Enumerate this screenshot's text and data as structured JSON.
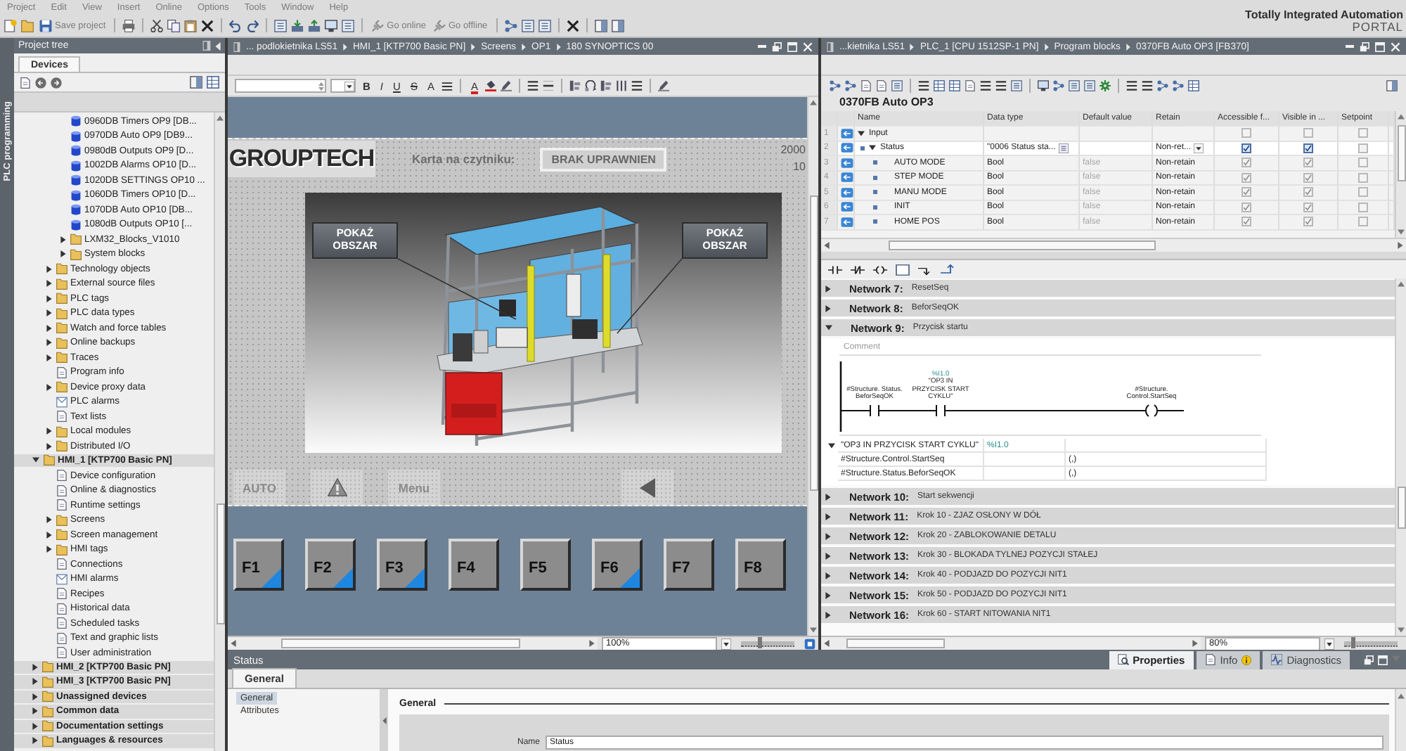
{
  "menu_bar": {
    "items": [
      "Project",
      "Edit",
      "View",
      "Insert",
      "Online",
      "Options",
      "Tools",
      "Window",
      "Help"
    ]
  },
  "toolbar": {
    "buttons": [
      {
        "kind": "save",
        "label": "Save project"
      },
      {
        "kind": "online",
        "label": "Go online"
      },
      {
        "kind": "offline",
        "label": "Go offline"
      }
    ]
  },
  "brand": {
    "title": "Totally Integrated Automation",
    "subtitle": "PORTAL"
  },
  "side_tab": {
    "label": "PLC programming"
  },
  "project_tree": {
    "title": "Project tree",
    "tabs": [
      {
        "label": "Devices",
        "selected": true
      }
    ],
    "items": [
      {
        "children": [
          {
            "children": [
              {
                "label": "0960DB Timers OP9 [DB...",
                "kind": "db"
              },
              {
                "label": "0970DB Auto OP9 [DB9...",
                "kind": "db"
              },
              {
                "label": "0980dB Outputs OP9 [D...",
                "kind": "db"
              },
              {
                "label": "1002DB Alarms OP10 [D...",
                "kind": "db"
              },
              {
                "label": "1020DB SETTINGS OP10 ...",
                "kind": "db"
              },
              {
                "label": "1060DB Timers OP10 [D...",
                "kind": "db"
              },
              {
                "label": "1070DB Auto OP10 [DB...",
                "kind": "db"
              },
              {
                "label": "1080dB Outputs OP10 [...",
                "kind": "db"
              },
              {
                "label": "LXM32_Blocks_V1010",
                "kind": "folder",
                "expanded": false
              },
              {
                "label": "System blocks",
                "kind": "folder",
                "expanded": false
              }
            ]
          },
          {
            "label": "Technology objects",
            "kind": "folder",
            "expanded": false
          },
          {
            "label": "External source files",
            "kind": "folder",
            "expanded": false
          },
          {
            "label": "PLC tags",
            "kind": "folder",
            "expanded": false
          },
          {
            "label": "PLC data types",
            "kind": "folder",
            "expanded": false
          },
          {
            "label": "Watch and force tables",
            "kind": "folder",
            "expanded": false
          },
          {
            "label": "Online backups",
            "kind": "folder",
            "expanded": false
          },
          {
            "label": "Traces",
            "kind": "folder",
            "expanded": false
          },
          {
            "label": "Program info",
            "kind": "item"
          },
          {
            "label": "Device proxy data",
            "kind": "folder",
            "expanded": false
          },
          {
            "label": "PLC alarms",
            "kind": "alarm"
          },
          {
            "label": "Text lists",
            "kind": "item"
          },
          {
            "label": "Local modules",
            "kind": "folder",
            "expanded": false
          },
          {
            "label": "Distributed I/O",
            "kind": "folder",
            "expanded": false
          }
        ]
      },
      {
        "label": "HMI_1 [KTP700 Basic PN]",
        "kind": "folder",
        "expanded": true,
        "children": [
          {
            "label": "Device configuration",
            "kind": "item"
          },
          {
            "label": "Online & diagnostics",
            "kind": "item"
          },
          {
            "label": "Runtime settings",
            "kind": "item"
          },
          {
            "label": "Screens",
            "kind": "folder",
            "expanded": false
          },
          {
            "label": "Screen management",
            "kind": "folder",
            "expanded": false
          },
          {
            "label": "HMI tags",
            "kind": "folder",
            "expanded": false
          },
          {
            "label": "Connections",
            "kind": "item"
          },
          {
            "label": "HMI alarms",
            "kind": "alarm"
          },
          {
            "label": "Recipes",
            "kind": "item"
          },
          {
            "label": "Historical data",
            "kind": "item"
          },
          {
            "label": "Scheduled tasks",
            "kind": "item"
          },
          {
            "label": "Text and graphic lists",
            "kind": "item"
          },
          {
            "label": "User administration",
            "kind": "item"
          }
        ]
      },
      {
        "label": "HMI_2 [KTP700 Basic PN]",
        "kind": "folder",
        "expanded": false
      },
      {
        "label": "HMI_3 [KTP700 Basic PN]",
        "kind": "folder",
        "expanded": false
      },
      {
        "label": "Unassigned devices",
        "kind": "folder",
        "expanded": false
      },
      {
        "label": "Common data",
        "kind": "folder",
        "expanded": false
      },
      {
        "label": "Documentation settings",
        "kind": "folder",
        "expanded": false
      },
      {
        "label": "Languages & resources",
        "kind": "folder",
        "expanded": false
      }
    ]
  },
  "hmi_editor": {
    "breadcrumb": [
      "... podlokietnika LS51",
      "HMI_1 [KTP700 Basic PN]",
      "Screens",
      "OP1",
      "180 SYNOPTICS 00"
    ],
    "format_toolbar": {
      "text_buttons": [
        {
          "label": "B",
          "kind": "bold"
        },
        {
          "label": "I",
          "kind": "italic"
        },
        {
          "label": "U",
          "kind": "underline"
        },
        {
          "label": "S",
          "kind": "strike"
        },
        {
          "label": "A",
          "kind": "grow"
        },
        {
          "label": "A",
          "kind": "color"
        }
      ]
    },
    "screen": {
      "logo": "GROUPTECH",
      "card_label": "Karta na czytniku:",
      "card_status": "BRAK UPRAWNIEN",
      "corner_values": [
        "2000",
        "10"
      ],
      "overlay_buttons": [
        {
          "label": "POKAŻ OBSZAR"
        },
        {
          "label": "POKAŻ OBSZAR"
        }
      ],
      "nav_buttons": [
        {
          "kind": "text",
          "label": "AUTO"
        },
        {
          "kind": "warning"
        },
        {
          "kind": "text",
          "label": "Menu"
        },
        {
          "kind": "back"
        }
      ],
      "function_keys": [
        {
          "label": "F1",
          "corner_triangle": true
        },
        {
          "label": "F2",
          "corner_triangle": true
        },
        {
          "label": "F3",
          "corner_triangle": true
        },
        {
          "label": "F4",
          "corner_triangle": false
        },
        {
          "label": "F5",
          "corner_triangle": false
        },
        {
          "label": "F6",
          "corner_triangle": true
        },
        {
          "label": "F7",
          "corner_triangle": false
        },
        {
          "label": "F8",
          "corner_triangle": false
        }
      ]
    },
    "zoom": {
      "value": "100%",
      "level": 0.35
    }
  },
  "block_editor": {
    "breadcrumb": [
      "...kietnika LS51",
      "PLC_1 [CPU 1512SP-1 PN]",
      "Program blocks",
      "0370FB Auto OP3 [FB370]"
    ],
    "block_title": "0370FB Auto OP3",
    "interface": {
      "columns": [
        "Name",
        "Data type",
        "Default value",
        "Retain",
        "Accessible f...",
        "Visible in ...",
        "Setpoint"
      ],
      "rows": [
        {
          "number": "1",
          "name": "Input",
          "expanded": true,
          "selected": false,
          "editable": false,
          "accessible": false,
          "visible": false,
          "setpoint": false,
          "children": [
            {
              "number": "2",
              "name": "Status",
              "expanded": true,
              "selected": true,
              "editable": true,
              "data_type": "\"0006 Status sta...",
              "retain": "Non-ret...",
              "accessible": true,
              "visible": true,
              "setpoint": false,
              "children": [
                {
                  "number": "3",
                  "name": "AUTO MODE",
                  "selected": false,
                  "editable": false,
                  "data_type": "Bool",
                  "default_value": "false",
                  "retain": "Non-retain",
                  "accessible": true,
                  "visible": true,
                  "setpoint": false
                },
                {
                  "number": "4",
                  "name": "STEP MODE",
                  "selected": false,
                  "editable": false,
                  "data_type": "Bool",
                  "default_value": "false",
                  "retain": "Non-retain",
                  "accessible": true,
                  "visible": true,
                  "setpoint": false
                },
                {
                  "number": "5",
                  "name": "MANU MODE",
                  "selected": false,
                  "editable": false,
                  "data_type": "Bool",
                  "default_value": "false",
                  "retain": "Non-retain",
                  "accessible": true,
                  "visible": true,
                  "setpoint": false
                },
                {
                  "number": "6",
                  "name": "INIT",
                  "selected": false,
                  "editable": false,
                  "data_type": "Bool",
                  "default_value": "false",
                  "retain": "Non-retain",
                  "accessible": true,
                  "visible": true,
                  "setpoint": false
                },
                {
                  "number": "7",
                  "name": "HOME POS",
                  "selected": false,
                  "editable": false,
                  "data_type": "Bool",
                  "default_value": "false",
                  "retain": "Non-retain",
                  "accessible": true,
                  "visible": true,
                  "setpoint": false
                }
              ]
            }
          ]
        }
      ]
    },
    "networks": [
      {
        "title": "Network 7:",
        "comment": "ResetSeq",
        "expanded": false
      },
      {
        "title": "Network 8:",
        "comment": "BeforSeqOK",
        "expanded": false
      },
      {
        "title": "Network 9:",
        "comment": "Przycisk startu",
        "expanded": true,
        "comment_field": {
          "placeholder": "Comment"
        },
        "ladder": [
          {
            "kind": "contact",
            "operand": "#Structure. Status. BeforSeqOK"
          },
          {
            "kind": "contact",
            "address": "%I1.0",
            "operand": "\"OP3 IN PRZYCISK START CYKLU\""
          },
          {
            "kind": "coil",
            "operand": "#Structure. Control.StartSeq"
          }
        ],
        "tag_info": {
          "expanded": true,
          "rows": [
            {
              "name": "\"OP3 IN PRZYCISK START CYKLU\"",
              "address": "%I1.0"
            },
            {
              "name": "#Structure.Control.StartSeq",
              "value": "(,)"
            },
            {
              "name": "#Structure.Status.BeforSeqOK",
              "value": "(,)"
            }
          ]
        }
      },
      {
        "title": "Network 10:",
        "comment": "Start sekwencji",
        "expanded": false
      },
      {
        "title": "Network 11:",
        "comment": "Krok 10 - ZJAZ OSŁONY W DÓŁ",
        "expanded": false
      },
      {
        "title": "Network 12:",
        "comment": "Krok 20 - ZABLOKOWANIE DETALU",
        "expanded": false
      },
      {
        "title": "Network 13:",
        "comment": "Krok 30 - BLOKADA TYLNEJ POZYCJI STAŁEJ",
        "expanded": false
      },
      {
        "title": "Network 14:",
        "comment": "Krok 40 - PODJAZD DO POZYCJI NIT1",
        "expanded": false
      },
      {
        "title": "Network 15:",
        "comment": "Krok 50 - PODJAZD DO POZYCJI NIT1",
        "expanded": false
      },
      {
        "title": "Network 16:",
        "comment": "Krok 60 - START NITOWANIA NIT1",
        "expanded": false
      }
    ],
    "zoom": {
      "value": "80%",
      "level": 0.15
    }
  },
  "inspector": {
    "title": "Status",
    "tabs": [
      {
        "label": "Properties",
        "kind": "properties",
        "selected": true
      },
      {
        "label": "Info",
        "kind": "info",
        "selected": false
      },
      {
        "label": "Diagnostics",
        "kind": "diagnostics",
        "selected": false
      }
    ],
    "subtabs": [
      {
        "label": "General",
        "selected": true
      }
    ],
    "nav": [
      {
        "label": "General",
        "selected": true
      },
      {
        "label": "Attributes",
        "selected": false
      }
    ],
    "section": "General",
    "fields": [
      {
        "label": "Name",
        "value": "Status"
      }
    ]
  }
}
